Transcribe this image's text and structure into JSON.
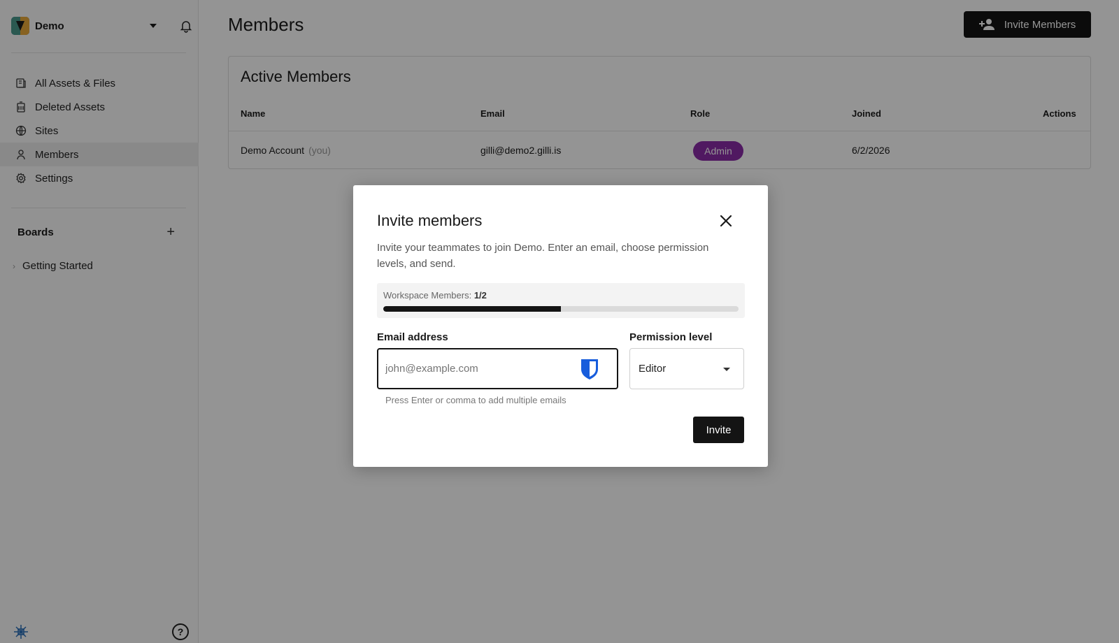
{
  "workspace": {
    "name": "Demo"
  },
  "sidebar": {
    "items": [
      {
        "label": "All Assets & Files"
      },
      {
        "label": "Deleted Assets"
      },
      {
        "label": "Sites"
      },
      {
        "label": "Members"
      },
      {
        "label": "Settings"
      }
    ],
    "boards_title": "Boards",
    "boards": [
      {
        "label": "Getting Started"
      }
    ]
  },
  "page": {
    "title": "Members",
    "invite_button": "Invite Members"
  },
  "members_table": {
    "title": "Active Members",
    "columns": [
      "Name",
      "Email",
      "Role",
      "Joined",
      "Actions"
    ],
    "rows": [
      {
        "name": "Demo Account",
        "you": "(you)",
        "email": "gilli@demo2.gilli.is",
        "role": "Admin",
        "joined": "6/2/2026"
      }
    ]
  },
  "modal": {
    "title": "Invite members",
    "description": "Invite your teammates to join Demo. Enter an email, choose permission levels, and send.",
    "quota_label": "Workspace Members:",
    "quota_value": "1/2",
    "quota_fraction": 0.5,
    "email_label": "Email address",
    "email_placeholder": "john@example.com",
    "hint": "Press Enter or comma to add multiple emails",
    "permission_label": "Permission level",
    "permission_value": "Editor",
    "invite_button": "Invite"
  },
  "colors": {
    "accent": "#141414",
    "admin_badge": "#8a2ba8",
    "overlay": "rgba(0,0,0,0.42)"
  }
}
